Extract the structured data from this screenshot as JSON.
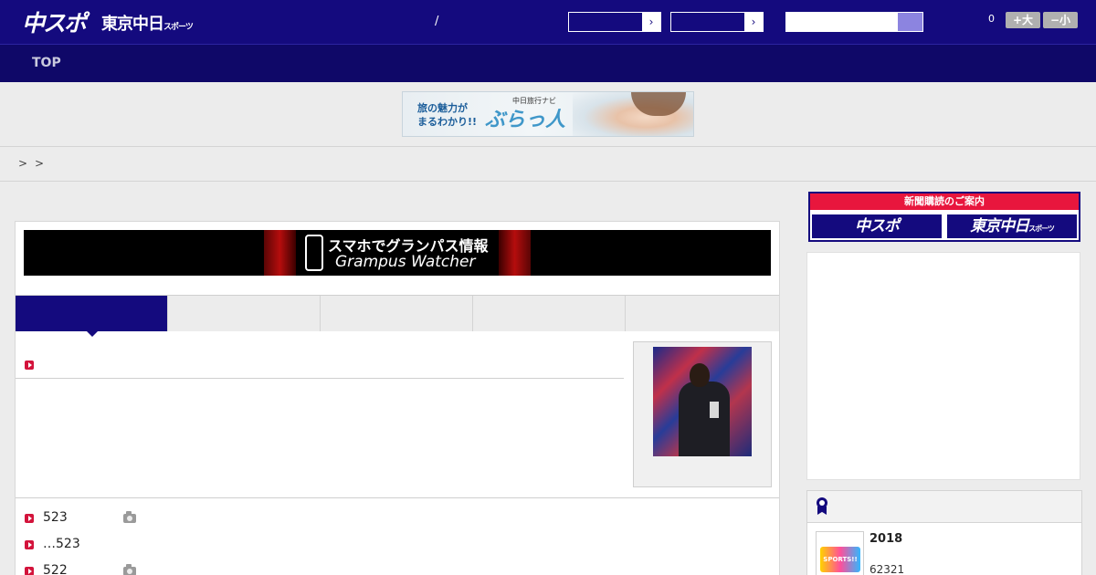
{
  "header": {
    "logo_chuspo": "中スポ",
    "logo_tokyo": "東京中日",
    "logo_tokyo_small": "スポーツ",
    "slash": "/",
    "select_arrow": "›",
    "search_placeholder": "",
    "font_size_count": "0",
    "font_larger_label": "+大",
    "font_smaller_label": "−小"
  },
  "nav": {
    "top_label": "TOP"
  },
  "travel_banner": {
    "line1": "旅の魅力が",
    "line2": "まるわかり!!",
    "small": "中日旅行ナビ",
    "name": "ぶらっ人"
  },
  "breadcrumb": {
    "separators": [
      ">",
      ">"
    ]
  },
  "grampus_banner": {
    "line1": "スマホでグランパス情報",
    "line2": "Grampus Watcher"
  },
  "tabs": [
    "",
    "",
    "",
    "",
    ""
  ],
  "article_list": [
    {
      "text": "523",
      "has_photo": true
    },
    {
      "text": "…523",
      "has_photo": false
    },
    {
      "text": "522",
      "has_photo": true
    }
  ],
  "sidebar": {
    "subscribe_heading": "新聞購読のご案内",
    "subscribe_chuspo": "中スポ",
    "subscribe_tokyo": "東京中日",
    "subscribe_tokyo_small": "スポーツ",
    "ranking": {
      "item_title": "2018",
      "item_number": "62321",
      "thumb_label": "SPORTS!!"
    }
  },
  "colors": {
    "brand_navy": "#140a7e",
    "nav_dark": "#0f0868",
    "accent_red": "#e8163d",
    "bullet_red": "#d3133b"
  }
}
